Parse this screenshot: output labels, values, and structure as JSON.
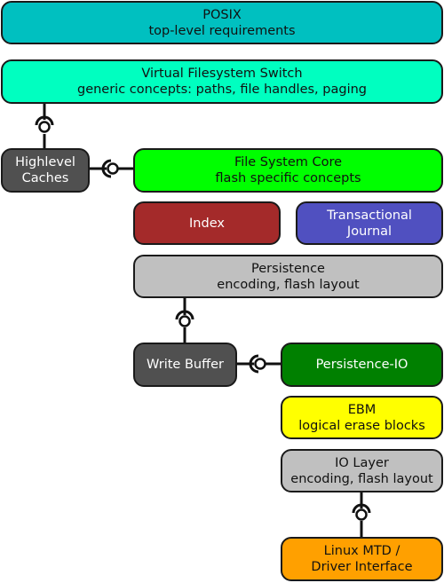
{
  "diagram": {
    "nodes": [
      {
        "id": "posix",
        "title": "POSIX",
        "subtitle": "top-level requirements",
        "color": "#00c0c0"
      },
      {
        "id": "vfs",
        "title": "Virtual Filesystem Switch",
        "subtitle": "generic concepts: paths, file handles, paging",
        "color": "#00ffc0"
      },
      {
        "id": "caches",
        "title": "Highlevel",
        "subtitle": "Caches",
        "color": "#505050"
      },
      {
        "id": "fscore",
        "title": "File System Core",
        "subtitle": "flash specific concepts",
        "color": "#00ff00"
      },
      {
        "id": "index",
        "title": "Index",
        "subtitle": "",
        "color": "#a42a2a"
      },
      {
        "id": "journal",
        "title": "Transactional",
        "subtitle": "Journal",
        "color": "#5050c0"
      },
      {
        "id": "persistence",
        "title": "Persistence",
        "subtitle": "encoding, flash layout",
        "color": "#c0c0c0"
      },
      {
        "id": "writebuffer",
        "title": "Write Buffer",
        "subtitle": "",
        "color": "#505050"
      },
      {
        "id": "persistenceio",
        "title": "Persistence-IO",
        "subtitle": "",
        "color": "#008000"
      },
      {
        "id": "ebm",
        "title": "EBM",
        "subtitle": "logical erase blocks",
        "color": "#ffff00"
      },
      {
        "id": "iolayer",
        "title": "IO Layer",
        "subtitle": "encoding, flash layout",
        "color": "#c0c0c0"
      },
      {
        "id": "mtd",
        "title": "Linux MTD /",
        "subtitle": "Driver Interface",
        "color": "#ffa000"
      }
    ],
    "links": [
      {
        "from": "vfs",
        "to": "caches",
        "type": "ball-and-socket"
      },
      {
        "from": "caches",
        "to": "fscore",
        "type": "ball-and-socket"
      },
      {
        "from": "persistence",
        "to": "writebuffer",
        "type": "ball-and-socket"
      },
      {
        "from": "writebuffer",
        "to": "persistenceio",
        "type": "ball-and-socket"
      },
      {
        "from": "iolayer",
        "to": "mtd",
        "type": "ball-and-socket"
      }
    ]
  }
}
